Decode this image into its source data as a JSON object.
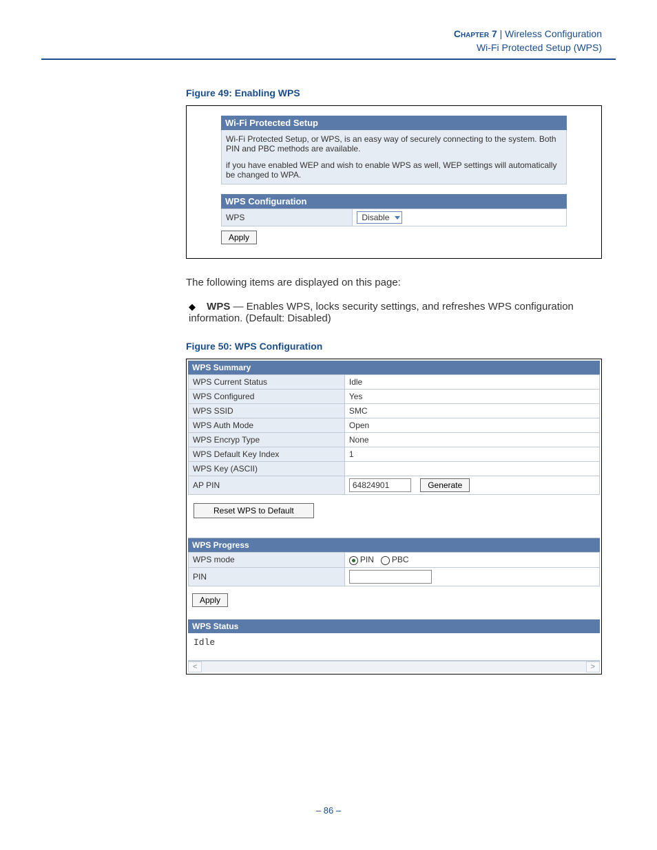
{
  "header": {
    "chapter": "Chapter 7",
    "separator": "|",
    "section": "Wireless Configuration",
    "subsection": "Wi-Fi Protected Setup (WPS)"
  },
  "figure49": {
    "caption": "Figure 49:  Enabling WPS",
    "panel_title": "Wi-Fi Protected Setup",
    "info1": "Wi-Fi Protected Setup, or WPS, is an easy way of securely connecting to the system. Both PIN and PBC methods are available.",
    "info2": "if you have enabled WEP and wish to enable WPS as well, WEP settings will automatically be changed to WPA.",
    "config_title": "WPS Configuration",
    "wps_label": "WPS",
    "wps_value": "Disable",
    "apply": "Apply"
  },
  "body": {
    "intro": "The following items are displayed on this page:",
    "bullet_bold": "WPS",
    "bullet_rest": " — Enables WPS, locks security settings, and refreshes WPS configuration information. (Default: Disabled)"
  },
  "figure50": {
    "caption": "Figure 50:  WPS Configuration",
    "summary_title": "WPS Summary",
    "rows": [
      {
        "label": "WPS Current Status",
        "value": "Idle"
      },
      {
        "label": "WPS Configured",
        "value": "Yes"
      },
      {
        "label": "WPS SSID",
        "value": "SMC"
      },
      {
        "label": "WPS Auth Mode",
        "value": "Open"
      },
      {
        "label": "WPS Encryp Type",
        "value": "None"
      },
      {
        "label": "WPS Default Key Index",
        "value": "1"
      },
      {
        "label": "WPS Key (ASCII)",
        "value": ""
      }
    ],
    "ap_pin_label": "AP PIN",
    "ap_pin_value": "64824901",
    "generate": "Generate",
    "reset": "Reset WPS to Default",
    "progress_title": "WPS Progress",
    "mode_label": "WPS mode",
    "mode_pin": "PIN",
    "mode_pbc": "PBC",
    "pin_label": "PIN",
    "apply": "Apply",
    "status_title": "WPS Status",
    "status_value": "Idle"
  },
  "page_number": "–  86  –"
}
